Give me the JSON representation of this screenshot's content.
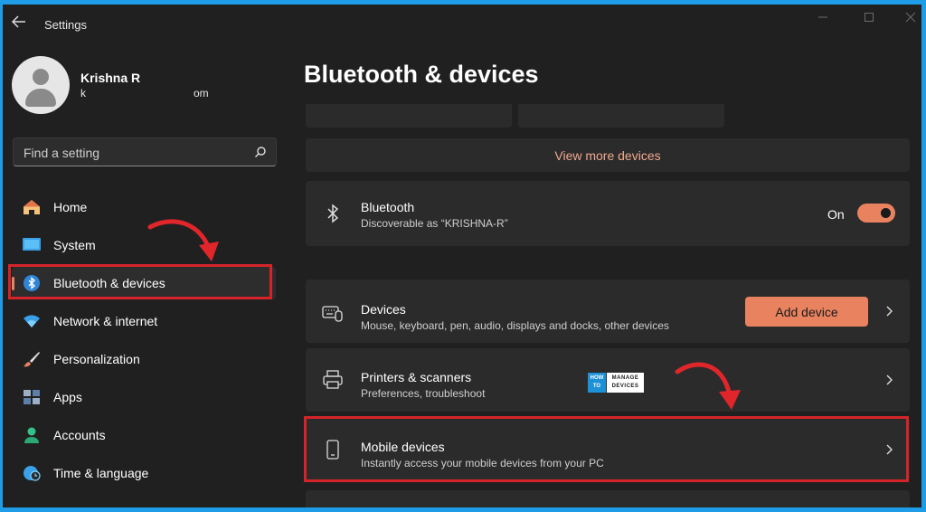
{
  "window": {
    "title": "Settings"
  },
  "profile": {
    "name": "Krishna R",
    "email_start": "k",
    "email_end": "om"
  },
  "search": {
    "placeholder": "Find a setting"
  },
  "nav": {
    "items": [
      {
        "label": "Home",
        "icon": "home-icon"
      },
      {
        "label": "System",
        "icon": "system-icon"
      },
      {
        "label": "Bluetooth & devices",
        "icon": "bluetooth-icon"
      },
      {
        "label": "Network & internet",
        "icon": "wifi-icon"
      },
      {
        "label": "Personalization",
        "icon": "brush-icon"
      },
      {
        "label": "Apps",
        "icon": "apps-icon"
      },
      {
        "label": "Accounts",
        "icon": "person-icon"
      },
      {
        "label": "Time & language",
        "icon": "globe-clock-icon"
      }
    ],
    "active": "Bluetooth & devices"
  },
  "main": {
    "title": "Bluetooth & devices",
    "view_more": "View more devices",
    "bluetooth": {
      "title": "Bluetooth",
      "subtitle": "Discoverable as “KRISHNA-R”",
      "state": "On",
      "on": true
    },
    "devices": {
      "title": "Devices",
      "subtitle": "Mouse, keyboard, pen, audio, displays and docks, other devices",
      "button": "Add device"
    },
    "printers": {
      "title": "Printers & scanners",
      "subtitle": "Preferences, troubleshoot"
    },
    "mobile": {
      "title": "Mobile devices",
      "subtitle": "Instantly access your mobile devices from your PC"
    }
  },
  "watermark": {
    "left_top": "HOW",
    "left_bottom": "TO",
    "right_top": "MANAGE",
    "right_bottom": "DEVICES"
  },
  "colors": {
    "accent": "#e8825f",
    "highlight_box": "#d4242a",
    "annotation_arrow": "#e0262b",
    "frame": "#1e9ce8"
  }
}
